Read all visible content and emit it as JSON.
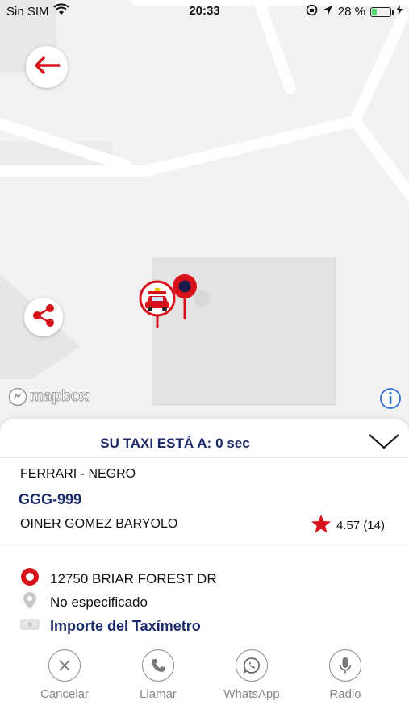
{
  "status_bar": {
    "carrier": "Sin SIM",
    "time": "20:33",
    "battery_percent": "28 %",
    "battery_level": 0.28
  },
  "map": {
    "attribution": "mapbox",
    "icons": [
      "back-arrow-icon",
      "share-icon",
      "taxi-marker-icon",
      "destination-pin-icon",
      "info-icon"
    ]
  },
  "trip": {
    "eta_label": "SU TAXI ESTÁ A:",
    "eta_value": "0 sec",
    "car": "FERRARI - NEGRO",
    "plate": "GGG-999",
    "driver": "OINER GOMEZ BARYOLO",
    "rating": "4.57 (14)"
  },
  "addresses": {
    "origin": "12750 BRIAR FOREST DR",
    "destination": "No especificado",
    "fare_label": "Importe del Taxímetro"
  },
  "actions": {
    "cancel": "Cancelar",
    "call": "Llamar",
    "whatsapp": "WhatsApp",
    "radio": "Radio"
  },
  "colors": {
    "accent_red": "#d8121b",
    "navy": "#1b2a6b",
    "map_bg": "#f2f2f2",
    "battery_green": "#4cd964"
  }
}
